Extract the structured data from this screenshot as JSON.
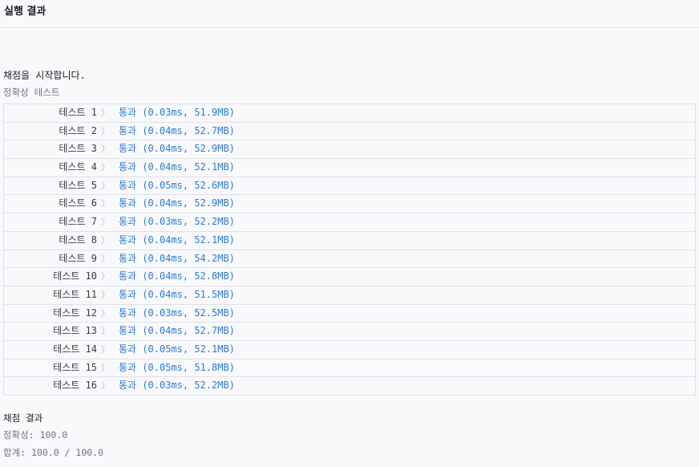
{
  "header": {
    "title": "실행 결과"
  },
  "console": {
    "start_message": "채점을 시작합니다.",
    "section_label": "정확성  테스트",
    "tests": [
      {
        "label": "테스트 1",
        "status": "통과",
        "detail": "(0.03ms, 51.9MB)"
      },
      {
        "label": "테스트 2",
        "status": "통과",
        "detail": "(0.04ms, 52.7MB)"
      },
      {
        "label": "테스트 3",
        "status": "통과",
        "detail": "(0.04ms, 52.9MB)"
      },
      {
        "label": "테스트 4",
        "status": "통과",
        "detail": "(0.04ms, 52.1MB)"
      },
      {
        "label": "테스트 5",
        "status": "통과",
        "detail": "(0.05ms, 52.6MB)"
      },
      {
        "label": "테스트 6",
        "status": "통과",
        "detail": "(0.04ms, 52.9MB)"
      },
      {
        "label": "테스트 7",
        "status": "통과",
        "detail": "(0.03ms, 52.2MB)"
      },
      {
        "label": "테스트 8",
        "status": "통과",
        "detail": "(0.04ms, 52.1MB)"
      },
      {
        "label": "테스트 9",
        "status": "통과",
        "detail": "(0.04ms, 54.2MB)"
      },
      {
        "label": "테스트 10",
        "status": "통과",
        "detail": "(0.04ms, 52.8MB)"
      },
      {
        "label": "테스트 11",
        "status": "통과",
        "detail": "(0.04ms, 51.5MB)"
      },
      {
        "label": "테스트 12",
        "status": "통과",
        "detail": "(0.03ms, 52.5MB)"
      },
      {
        "label": "테스트 13",
        "status": "통과",
        "detail": "(0.04ms, 52.7MB)"
      },
      {
        "label": "테스트 14",
        "status": "통과",
        "detail": "(0.05ms, 52.1MB)"
      },
      {
        "label": "테스트 15",
        "status": "통과",
        "detail": "(0.05ms, 51.8MB)"
      },
      {
        "label": "테스트 16",
        "status": "통과",
        "detail": "(0.03ms, 52.2MB)"
      }
    ],
    "chevron_icon": "chevron-right-icon",
    "chevron_glyph": "〉"
  },
  "summary": {
    "title": "채점 결과",
    "accuracy": "정확성: 100.0",
    "total": "합계: 100.0 / 100.0"
  },
  "colors": {
    "pass": "#2c7cd0",
    "text": "#3a3d45",
    "muted": "#6b7686",
    "border": "#dde2ea",
    "background": "#f9f9fc"
  }
}
